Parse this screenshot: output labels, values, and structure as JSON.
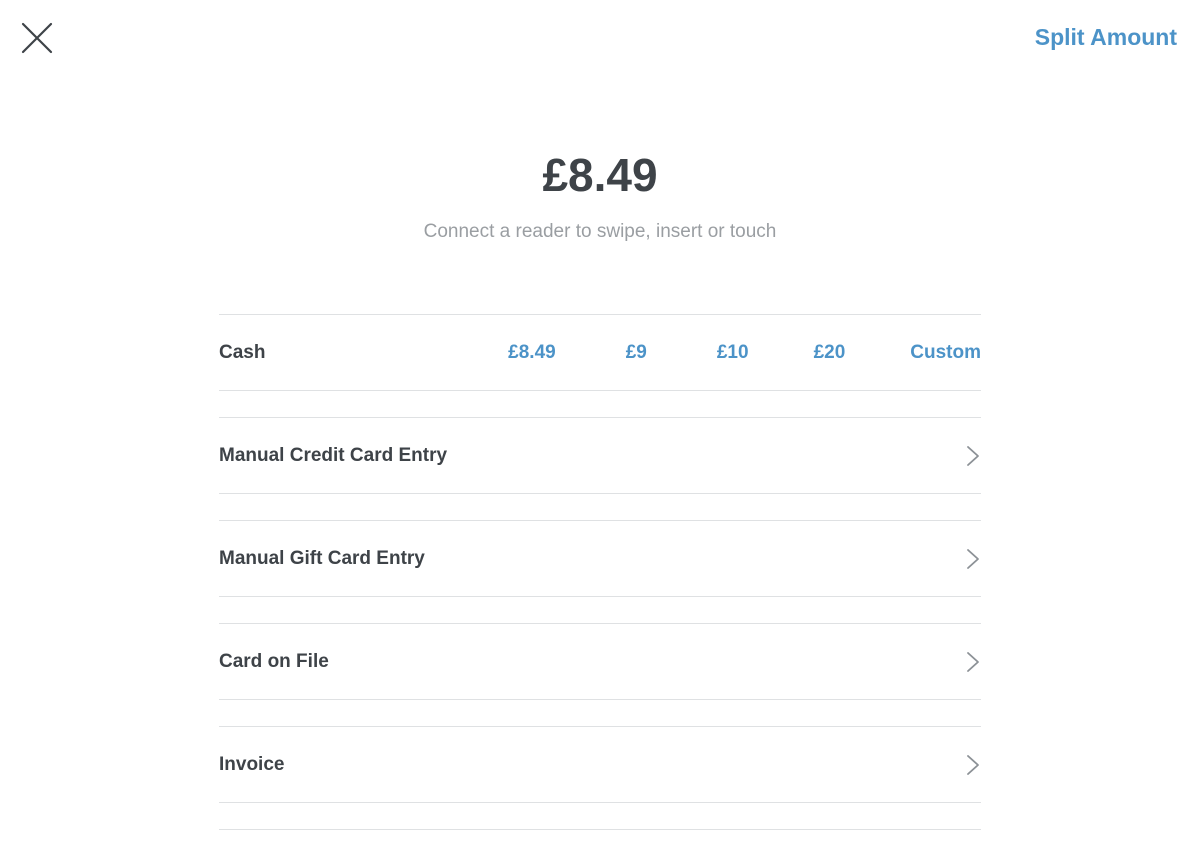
{
  "header": {
    "close_icon": "close-icon",
    "split_amount_label": "Split Amount"
  },
  "payment": {
    "amount": "£8.49",
    "hint": "Connect a reader to swipe, insert or touch"
  },
  "cash": {
    "label": "Cash",
    "options": [
      "£8.49",
      "£9",
      "£10",
      "£20",
      "Custom"
    ]
  },
  "methods": [
    {
      "label": "Manual Credit Card Entry",
      "icon": "chevron-right-icon"
    },
    {
      "label": "Manual Gift Card Entry",
      "icon": "chevron-right-icon"
    },
    {
      "label": "Card on File",
      "icon": "chevron-right-icon"
    },
    {
      "label": "Invoice",
      "icon": "chevron-right-icon"
    }
  ],
  "colors": {
    "accent": "#4c93c8",
    "text": "#3e4348",
    "muted": "#9a9ea2",
    "divider": "#dfe1e3"
  }
}
